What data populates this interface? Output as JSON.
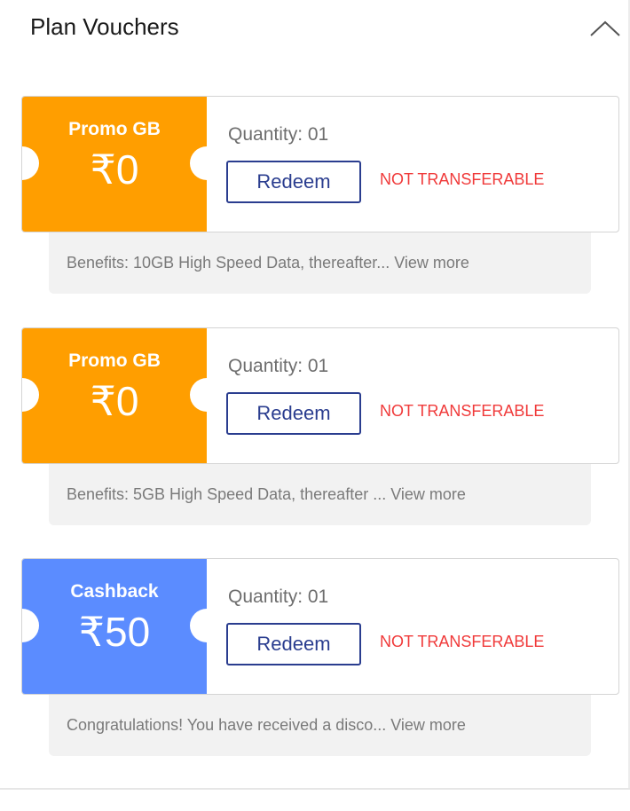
{
  "header": {
    "title": "Plan Vouchers",
    "collapse_icon": "chevron-up-icon"
  },
  "colors": {
    "promo_stub": "#ff9e00",
    "cashback_stub": "#5b8cff",
    "redeem_border": "#2a3d8f",
    "not_transferable": "#f03a3a",
    "benefits_bg": "#f2f2f2"
  },
  "vouchers": [
    {
      "type": "Promo GB",
      "amount": "₹0",
      "quantity": "Quantity: 01",
      "redeem_label": "Redeem",
      "transfer_status": "NOT TRANSFERABLE",
      "benefits": "Benefits: 10GB High Speed Data, thereafter... View more"
    },
    {
      "type": "Promo GB",
      "amount": "₹0",
      "quantity": "Quantity: 01",
      "redeem_label": "Redeem",
      "transfer_status": "NOT TRANSFERABLE",
      "benefits": "Benefits: 5GB High Speed Data, thereafter ... View more"
    },
    {
      "type": "Cashback",
      "amount": "₹50",
      "quantity": "Quantity: 01",
      "redeem_label": "Redeem",
      "transfer_status": "NOT TRANSFERABLE",
      "benefits": "Congratulations! You have received a disco... View more"
    }
  ]
}
